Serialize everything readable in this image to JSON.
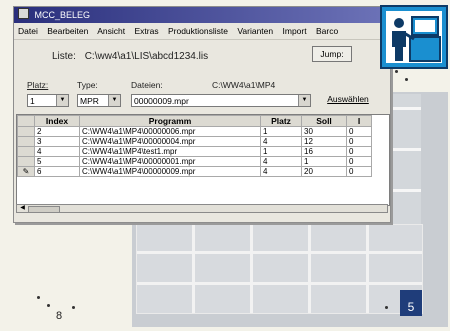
{
  "window": {
    "title": "MCC_BELEG"
  },
  "menu": [
    "Datei",
    "Bearbeiten",
    "Ansicht",
    "Extras",
    "Produktionsliste",
    "Varianten",
    "Import",
    "Barco"
  ],
  "liste": {
    "label": "Liste:",
    "path": "C:\\ww4\\a1\\LIS\\abcd1234.lis",
    "jump_label": "Jump:"
  },
  "fields": {
    "platz_label": "Platz:",
    "type_label": "Type:",
    "dateien_label": "Dateien:",
    "dateien_dir": "C:\\WW4\\a1\\MP4",
    "platz_value": "1",
    "type_value": "MPR",
    "dateien_value": "00000009.mpr",
    "auswaehlen_label": "Auswählen"
  },
  "table": {
    "headers": [
      "Index",
      "Programm",
      "Platz",
      "Soll",
      "I"
    ],
    "rows": [
      [
        "2",
        "C:\\WW4\\a1\\MP4\\00000006.mpr",
        "1",
        "30",
        "0"
      ],
      [
        "3",
        "C:\\WW4\\a1\\MP4\\00000004.mpr",
        "4",
        "12",
        "0"
      ],
      [
        "4",
        "C:\\WW4\\a1\\MP4\\test1.mpr",
        "1",
        "16",
        "0"
      ],
      [
        "5",
        "C:\\WW4\\a1\\MP4\\00000001.mpr",
        "4",
        "1",
        "0"
      ],
      [
        "6",
        "C:\\WW4\\a1\\MP4\\00000009.mpr",
        "4",
        "20",
        "0"
      ]
    ]
  },
  "page": {
    "left_number": "8",
    "right_number": "5"
  },
  "colors": {
    "title_bar": "#2a2f7c",
    "icon_bg": "#1a8fd0",
    "badge_bg": "#1f3d7a"
  }
}
